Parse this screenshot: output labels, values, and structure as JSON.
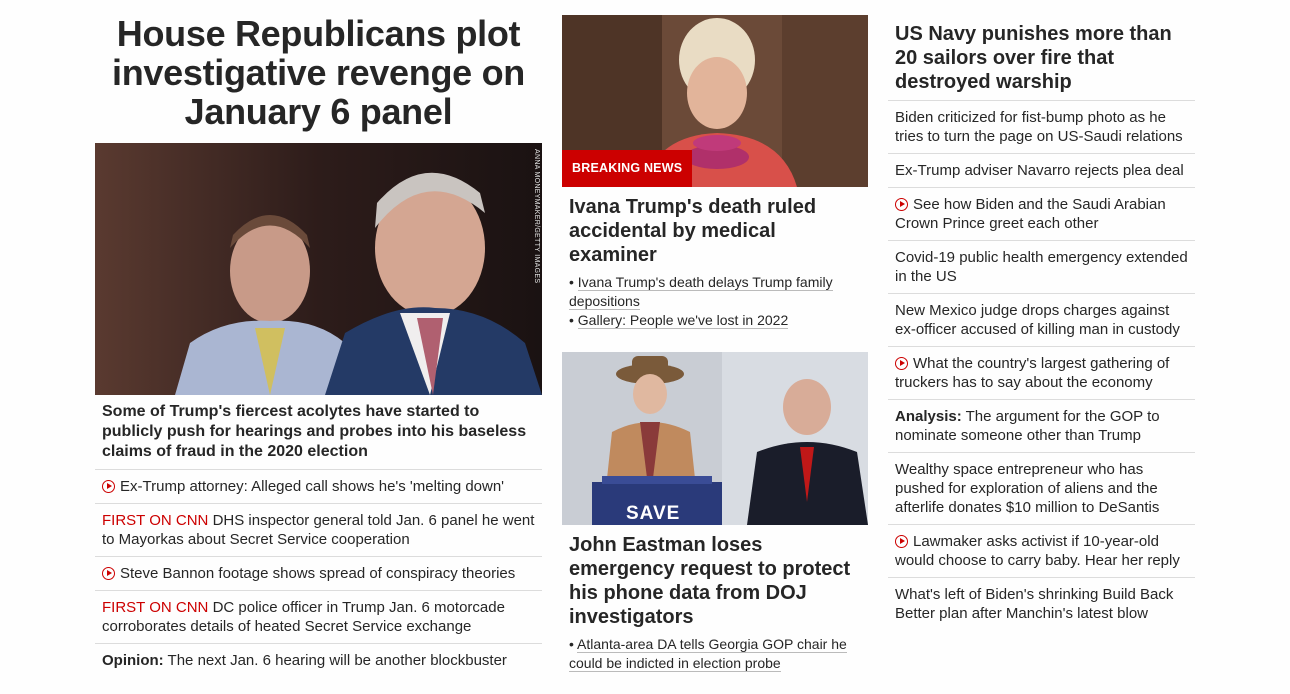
{
  "colors": {
    "accent_red": "#cc0000",
    "text": "#262626",
    "divider": "#dcdcdc"
  },
  "left": {
    "headline": "House Republicans plot investigative revenge on January 6 panel",
    "photo_credit": "ANNA MONEYMAKER/GETTY IMAGES",
    "description": "Some of Trump's fiercest acolytes have started to publicly push for hearings and probes into his baseless claims of fraud in the 2020 election",
    "items": [
      {
        "icon": "play-icon",
        "prefix": "",
        "text": "Ex-Trump attorney: Alleged call shows he's 'melting down'"
      },
      {
        "icon": "",
        "prefix": "FIRST ON CNN",
        "text": " DHS inspector general told Jan. 6 panel he went to Mayorkas about Secret Service cooperation"
      },
      {
        "icon": "play-icon",
        "prefix": "",
        "text": "Steve Bannon footage shows spread of conspiracy theories"
      },
      {
        "icon": "",
        "prefix": "FIRST ON CNN",
        "text": " DC police officer in Trump Jan. 6 motorcade corroborates details of heated Secret Service exchange"
      },
      {
        "icon": "",
        "bold_prefix": "Opinion:",
        "text": " The next Jan. 6 hearing will be another blockbuster"
      }
    ]
  },
  "middle": {
    "card1": {
      "badge": "BREAKING NEWS",
      "headline": "Ivana Trump's death ruled accidental by medical examiner",
      "links": [
        "Ivana Trump's death delays Trump family depositions",
        "Gallery: People we've lost in 2022"
      ]
    },
    "card2": {
      "sign_text": "SAVE",
      "headline": "John Eastman loses emergency request to protect his phone data from DOJ investigators",
      "links": [
        "Atlanta-area DA tells Georgia GOP chair he could be indicted in election probe"
      ]
    },
    "bullet": "•"
  },
  "right": {
    "headline": "US Navy punishes more than 20 sailors over fire that destroyed warship",
    "items": [
      {
        "icon": "",
        "text": "Biden criticized for fist-bump photo as he tries to turn the page on US-Saudi relations"
      },
      {
        "icon": "",
        "text": "Ex-Trump adviser Navarro rejects plea deal"
      },
      {
        "icon": "play-icon",
        "text": "See how Biden and the Saudi Arabian Crown Prince greet each other"
      },
      {
        "icon": "",
        "text": "Covid-19 public health emergency extended in the US"
      },
      {
        "icon": "",
        "text": "New Mexico judge drops charges against ex-officer accused of killing man in custody"
      },
      {
        "icon": "play-icon",
        "text": "What the country's largest gathering of truckers has to say about the economy"
      },
      {
        "icon": "",
        "bold_prefix": "Analysis:",
        "text": " The argument for the GOP to nominate someone other than Trump"
      },
      {
        "icon": "",
        "text": "Wealthy space entrepreneur who has pushed for exploration of aliens and the afterlife donates $10 million to DeSantis"
      },
      {
        "icon": "play-icon",
        "text": "Lawmaker asks activist if 10-year-old would choose to carry baby. Hear her reply"
      },
      {
        "icon": "",
        "text": "What's left of Biden's shrinking Build Back Better plan after Manchin's latest blow"
      }
    ]
  }
}
